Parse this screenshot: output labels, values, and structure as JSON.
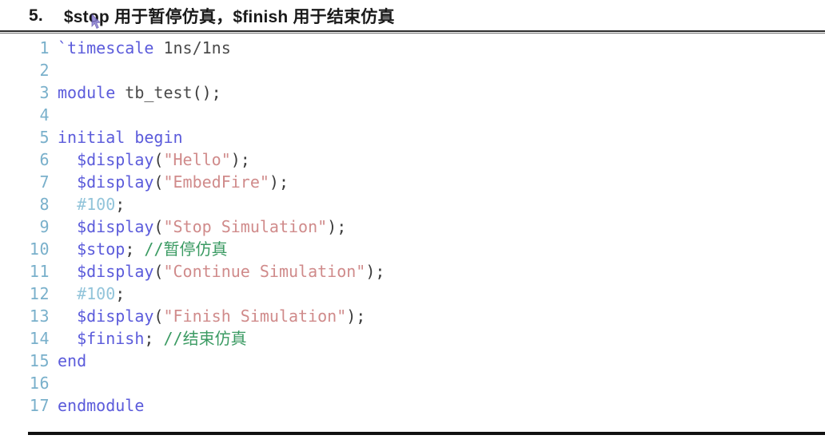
{
  "slide": {
    "number": "5.",
    "title": "$stop 用于暂停仿真，$finish 用于结束仿真"
  },
  "code": {
    "language": "verilog",
    "colors": {
      "keyword": "#5b5bdb",
      "system_task": "#5b5bdb",
      "string": "#d08b8b",
      "number": "#92c4da",
      "comment": "#3a9a62",
      "plain": "#4a4a4a",
      "line_number": "#79b0cb",
      "background": "#ffffff"
    },
    "lines": [
      {
        "n": "1",
        "text": "`timescale 1ns/1ns"
      },
      {
        "n": "2",
        "text": ""
      },
      {
        "n": "3",
        "text": "module tb_test();"
      },
      {
        "n": "4",
        "text": ""
      },
      {
        "n": "5",
        "text": "initial begin"
      },
      {
        "n": "6",
        "text": "  $display(\"Hello\");"
      },
      {
        "n": "7",
        "text": "  $display(\"EmbedFire\");"
      },
      {
        "n": "8",
        "text": "  #100;"
      },
      {
        "n": "9",
        "text": "  $display(\"Stop Simulation\");"
      },
      {
        "n": "10",
        "text": "  $stop; //暂停仿真"
      },
      {
        "n": "11",
        "text": "  $display(\"Continue Simulation\");"
      },
      {
        "n": "12",
        "text": "  #100;"
      },
      {
        "n": "13",
        "text": "  $display(\"Finish Simulation\");"
      },
      {
        "n": "14",
        "text": "  $finish; //结束仿真"
      },
      {
        "n": "15",
        "text": "end"
      },
      {
        "n": "16",
        "text": ""
      },
      {
        "n": "17",
        "text": "endmodule"
      }
    ],
    "tokens": [
      [
        {
          "t": "`timescale",
          "c": "kw"
        },
        {
          "t": " 1ns/1ns",
          "c": "plain"
        }
      ],
      [],
      [
        {
          "t": "module",
          "c": "kw"
        },
        {
          "t": " tb_test",
          "c": "plain"
        },
        {
          "t": "();",
          "c": "punct"
        }
      ],
      [],
      [
        {
          "t": "initial begin",
          "c": "kw"
        }
      ],
      [
        {
          "t": "  ",
          "c": "plain"
        },
        {
          "t": "$display",
          "c": "sys"
        },
        {
          "t": "(",
          "c": "punct"
        },
        {
          "t": "\"Hello\"",
          "c": "str"
        },
        {
          "t": ");",
          "c": "punct"
        }
      ],
      [
        {
          "t": "  ",
          "c": "plain"
        },
        {
          "t": "$display",
          "c": "sys"
        },
        {
          "t": "(",
          "c": "punct"
        },
        {
          "t": "\"EmbedFire\"",
          "c": "str"
        },
        {
          "t": ");",
          "c": "punct"
        }
      ],
      [
        {
          "t": "  ",
          "c": "plain"
        },
        {
          "t": "#100",
          "c": "num"
        },
        {
          "t": ";",
          "c": "punct"
        }
      ],
      [
        {
          "t": "  ",
          "c": "plain"
        },
        {
          "t": "$display",
          "c": "sys"
        },
        {
          "t": "(",
          "c": "punct"
        },
        {
          "t": "\"Stop Simulation\"",
          "c": "str"
        },
        {
          "t": ");",
          "c": "punct"
        }
      ],
      [
        {
          "t": "  ",
          "c": "plain"
        },
        {
          "t": "$stop",
          "c": "sys"
        },
        {
          "t": "; ",
          "c": "punct"
        },
        {
          "t": "//暂停仿真",
          "c": "cmt"
        }
      ],
      [
        {
          "t": "  ",
          "c": "plain"
        },
        {
          "t": "$display",
          "c": "sys"
        },
        {
          "t": "(",
          "c": "punct"
        },
        {
          "t": "\"Continue Simulation\"",
          "c": "str"
        },
        {
          "t": ");",
          "c": "punct"
        }
      ],
      [
        {
          "t": "  ",
          "c": "plain"
        },
        {
          "t": "#100",
          "c": "num"
        },
        {
          "t": ";",
          "c": "punct"
        }
      ],
      [
        {
          "t": "  ",
          "c": "plain"
        },
        {
          "t": "$display",
          "c": "sys"
        },
        {
          "t": "(",
          "c": "punct"
        },
        {
          "t": "\"Finish Simulation\"",
          "c": "str"
        },
        {
          "t": ");",
          "c": "punct"
        }
      ],
      [
        {
          "t": "  ",
          "c": "plain"
        },
        {
          "t": "$finish",
          "c": "sys"
        },
        {
          "t": "; ",
          "c": "punct"
        },
        {
          "t": "//结束仿真",
          "c": "cmt"
        }
      ],
      [
        {
          "t": "end",
          "c": "kw"
        }
      ],
      [],
      [
        {
          "t": "endmodule",
          "c": "kw"
        }
      ]
    ]
  },
  "icons": {
    "cursor": "mouse-pointer-icon"
  }
}
